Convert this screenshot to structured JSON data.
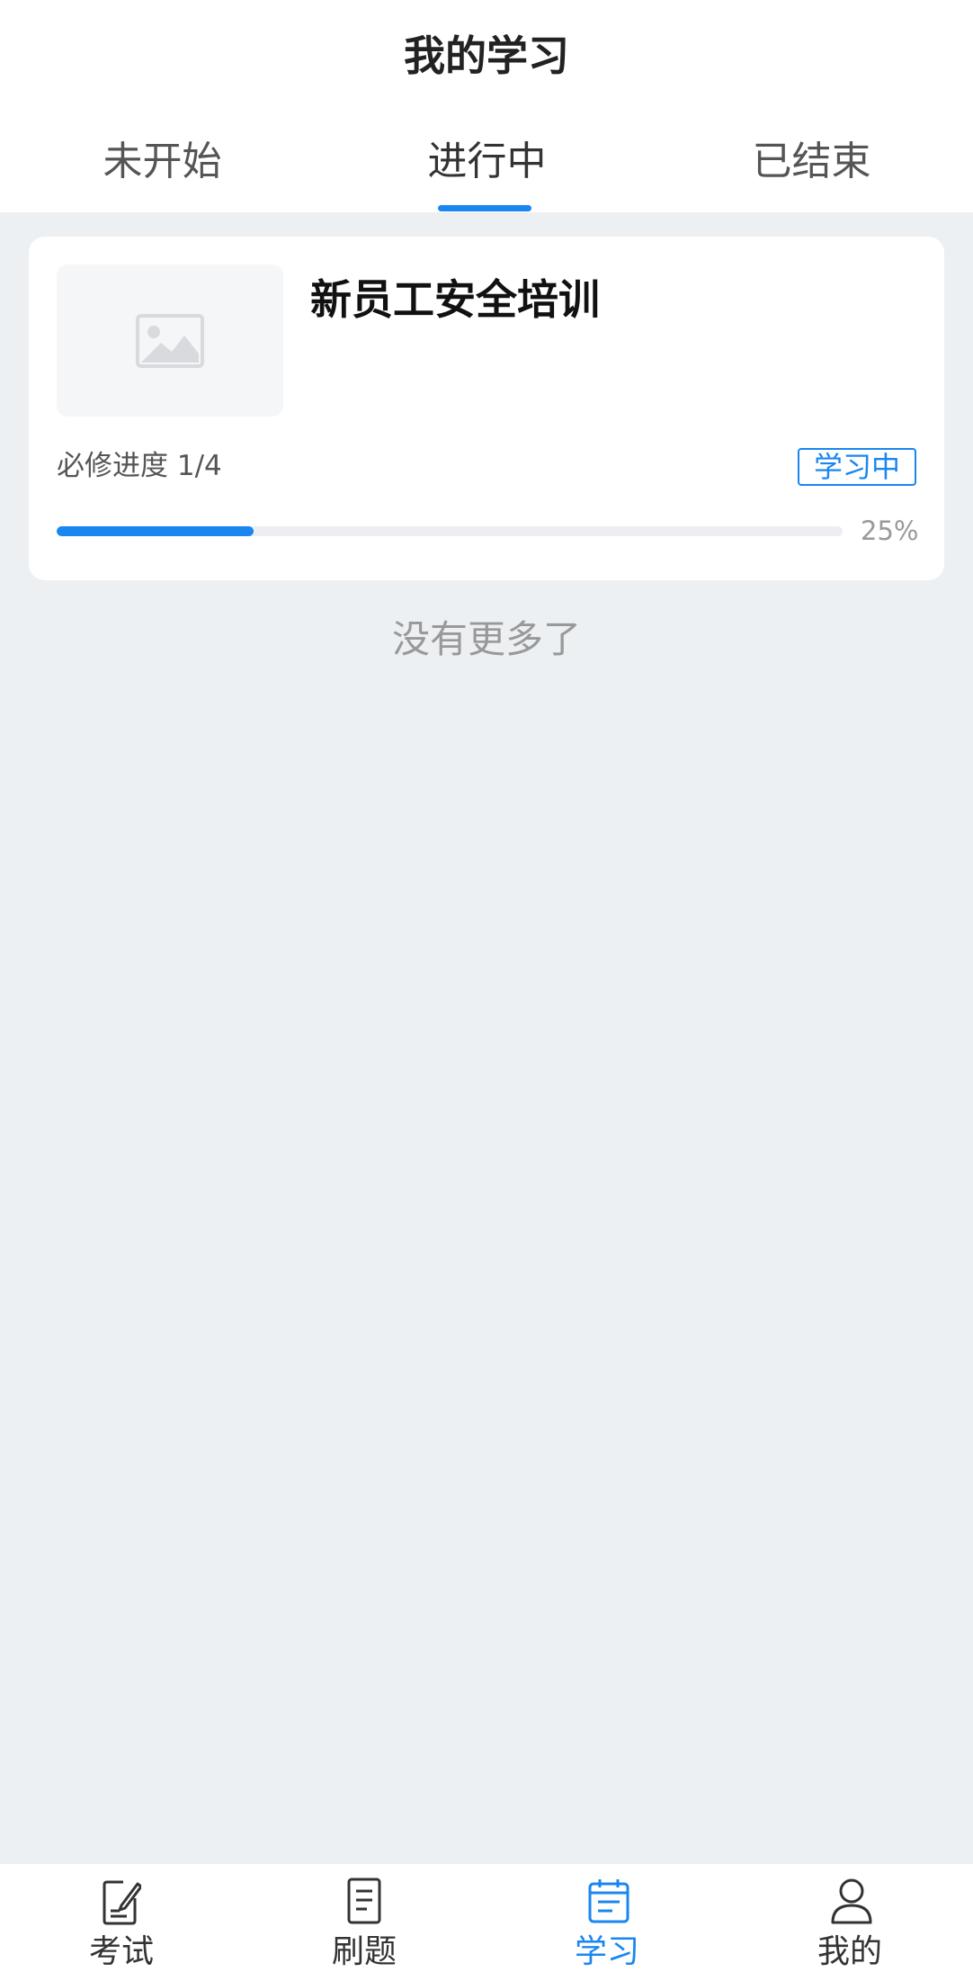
{
  "header": {
    "title": "我的学习",
    "tabs": [
      {
        "label": "未开始"
      },
      {
        "label": "进行中"
      },
      {
        "label": "已结束"
      }
    ]
  },
  "course": {
    "title": "新员工安全培训",
    "required_progress": "必修进度 1/4",
    "status": "学习中",
    "progress_fraction": 0.25,
    "progress_text": "25%"
  },
  "list_end_text": "没有更多了",
  "tabbar": {
    "items": [
      {
        "label": "考试",
        "icon": "exam-icon"
      },
      {
        "label": "刷题",
        "icon": "document-icon"
      },
      {
        "label": "学习",
        "icon": "study-icon"
      },
      {
        "label": "我的",
        "icon": "user-icon"
      }
    ]
  },
  "colors": {
    "accent": "#1a86f0",
    "background": "#edf0f3"
  }
}
